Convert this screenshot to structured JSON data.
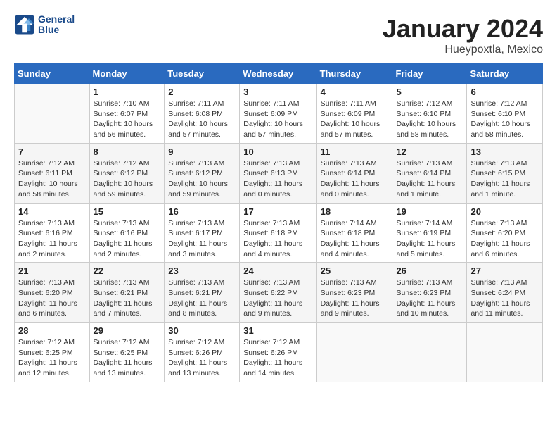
{
  "logo": {
    "line1": "General",
    "line2": "Blue"
  },
  "title": "January 2024",
  "location": "Hueypoxtla, Mexico",
  "weekdays": [
    "Sunday",
    "Monday",
    "Tuesday",
    "Wednesday",
    "Thursday",
    "Friday",
    "Saturday"
  ],
  "weeks": [
    [
      {
        "day": "",
        "info": ""
      },
      {
        "day": "1",
        "info": "Sunrise: 7:10 AM\nSunset: 6:07 PM\nDaylight: 10 hours\nand 56 minutes."
      },
      {
        "day": "2",
        "info": "Sunrise: 7:11 AM\nSunset: 6:08 PM\nDaylight: 10 hours\nand 57 minutes."
      },
      {
        "day": "3",
        "info": "Sunrise: 7:11 AM\nSunset: 6:09 PM\nDaylight: 10 hours\nand 57 minutes."
      },
      {
        "day": "4",
        "info": "Sunrise: 7:11 AM\nSunset: 6:09 PM\nDaylight: 10 hours\nand 57 minutes."
      },
      {
        "day": "5",
        "info": "Sunrise: 7:12 AM\nSunset: 6:10 PM\nDaylight: 10 hours\nand 58 minutes."
      },
      {
        "day": "6",
        "info": "Sunrise: 7:12 AM\nSunset: 6:10 PM\nDaylight: 10 hours\nand 58 minutes."
      }
    ],
    [
      {
        "day": "7",
        "info": "Sunrise: 7:12 AM\nSunset: 6:11 PM\nDaylight: 10 hours\nand 58 minutes."
      },
      {
        "day": "8",
        "info": "Sunrise: 7:12 AM\nSunset: 6:12 PM\nDaylight: 10 hours\nand 59 minutes."
      },
      {
        "day": "9",
        "info": "Sunrise: 7:13 AM\nSunset: 6:12 PM\nDaylight: 10 hours\nand 59 minutes."
      },
      {
        "day": "10",
        "info": "Sunrise: 7:13 AM\nSunset: 6:13 PM\nDaylight: 11 hours\nand 0 minutes."
      },
      {
        "day": "11",
        "info": "Sunrise: 7:13 AM\nSunset: 6:14 PM\nDaylight: 11 hours\nand 0 minutes."
      },
      {
        "day": "12",
        "info": "Sunrise: 7:13 AM\nSunset: 6:14 PM\nDaylight: 11 hours\nand 1 minute."
      },
      {
        "day": "13",
        "info": "Sunrise: 7:13 AM\nSunset: 6:15 PM\nDaylight: 11 hours\nand 1 minute."
      }
    ],
    [
      {
        "day": "14",
        "info": "Sunrise: 7:13 AM\nSunset: 6:16 PM\nDaylight: 11 hours\nand 2 minutes."
      },
      {
        "day": "15",
        "info": "Sunrise: 7:13 AM\nSunset: 6:16 PM\nDaylight: 11 hours\nand 2 minutes."
      },
      {
        "day": "16",
        "info": "Sunrise: 7:13 AM\nSunset: 6:17 PM\nDaylight: 11 hours\nand 3 minutes."
      },
      {
        "day": "17",
        "info": "Sunrise: 7:13 AM\nSunset: 6:18 PM\nDaylight: 11 hours\nand 4 minutes."
      },
      {
        "day": "18",
        "info": "Sunrise: 7:14 AM\nSunset: 6:18 PM\nDaylight: 11 hours\nand 4 minutes."
      },
      {
        "day": "19",
        "info": "Sunrise: 7:14 AM\nSunset: 6:19 PM\nDaylight: 11 hours\nand 5 minutes."
      },
      {
        "day": "20",
        "info": "Sunrise: 7:13 AM\nSunset: 6:20 PM\nDaylight: 11 hours\nand 6 minutes."
      }
    ],
    [
      {
        "day": "21",
        "info": "Sunrise: 7:13 AM\nSunset: 6:20 PM\nDaylight: 11 hours\nand 6 minutes."
      },
      {
        "day": "22",
        "info": "Sunrise: 7:13 AM\nSunset: 6:21 PM\nDaylight: 11 hours\nand 7 minutes."
      },
      {
        "day": "23",
        "info": "Sunrise: 7:13 AM\nSunset: 6:21 PM\nDaylight: 11 hours\nand 8 minutes."
      },
      {
        "day": "24",
        "info": "Sunrise: 7:13 AM\nSunset: 6:22 PM\nDaylight: 11 hours\nand 9 minutes."
      },
      {
        "day": "25",
        "info": "Sunrise: 7:13 AM\nSunset: 6:23 PM\nDaylight: 11 hours\nand 9 minutes."
      },
      {
        "day": "26",
        "info": "Sunrise: 7:13 AM\nSunset: 6:23 PM\nDaylight: 11 hours\nand 10 minutes."
      },
      {
        "day": "27",
        "info": "Sunrise: 7:13 AM\nSunset: 6:24 PM\nDaylight: 11 hours\nand 11 minutes."
      }
    ],
    [
      {
        "day": "28",
        "info": "Sunrise: 7:12 AM\nSunset: 6:25 PM\nDaylight: 11 hours\nand 12 minutes."
      },
      {
        "day": "29",
        "info": "Sunrise: 7:12 AM\nSunset: 6:25 PM\nDaylight: 11 hours\nand 13 minutes."
      },
      {
        "day": "30",
        "info": "Sunrise: 7:12 AM\nSunset: 6:26 PM\nDaylight: 11 hours\nand 13 minutes."
      },
      {
        "day": "31",
        "info": "Sunrise: 7:12 AM\nSunset: 6:26 PM\nDaylight: 11 hours\nand 14 minutes."
      },
      {
        "day": "",
        "info": ""
      },
      {
        "day": "",
        "info": ""
      },
      {
        "day": "",
        "info": ""
      }
    ]
  ]
}
